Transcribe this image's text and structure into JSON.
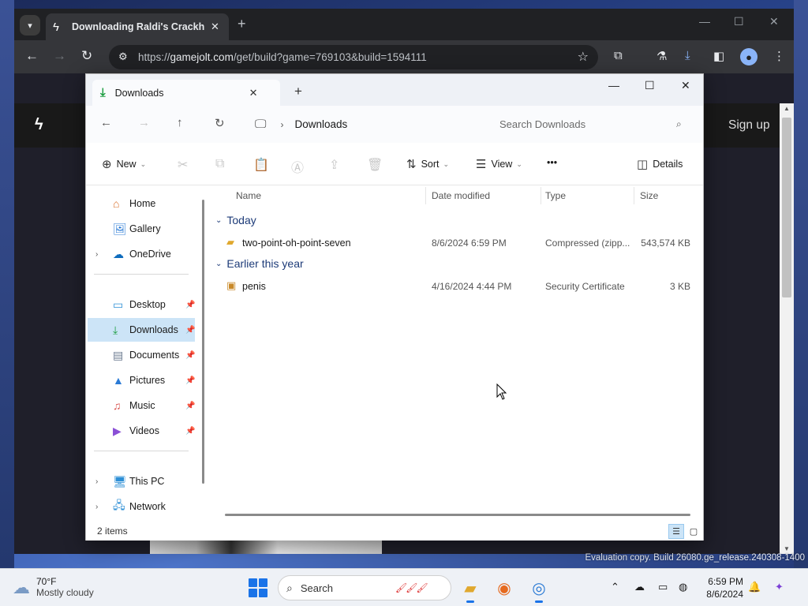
{
  "desktop": {
    "watermark": "Evaluation copy. Build 26080.ge_release.240308-1400"
  },
  "chrome": {
    "tab_title": "Downloading Raldi's Crackhou",
    "url_prefix": "https://",
    "url_host": "gamejolt.com",
    "url_path": "/get/build?game=769103&build=1594111",
    "page": {
      "signup": "Sign up"
    }
  },
  "explorer": {
    "tab_label": "Downloads",
    "location": "Downloads",
    "search_placeholder": "Search Downloads",
    "commands": {
      "new": "New",
      "sort": "Sort",
      "view": "View",
      "more": "•••",
      "details": "Details"
    },
    "nav_items": [
      {
        "label": "Home",
        "icon": "home-icon",
        "pinned": false,
        "expandable": false
      },
      {
        "label": "Gallery",
        "icon": "gallery-icon",
        "pinned": false,
        "expandable": false
      },
      {
        "label": "OneDrive",
        "icon": "cloud-icon",
        "pinned": false,
        "expandable": true
      },
      {
        "label": "Desktop",
        "icon": "desktop-icon",
        "pinned": true,
        "expandable": false
      },
      {
        "label": "Downloads",
        "icon": "download-icon",
        "pinned": true,
        "expandable": false,
        "selected": true
      },
      {
        "label": "Documents",
        "icon": "documents-icon",
        "pinned": true,
        "expandable": false
      },
      {
        "label": "Pictures",
        "icon": "pictures-icon",
        "pinned": true,
        "expandable": false
      },
      {
        "label": "Music",
        "icon": "music-icon",
        "pinned": true,
        "expandable": false
      },
      {
        "label": "Videos",
        "icon": "videos-icon",
        "pinned": true,
        "expandable": false
      },
      {
        "label": "This PC",
        "icon": "pc-icon",
        "pinned": false,
        "expandable": true
      },
      {
        "label": "Network",
        "icon": "network-icon",
        "pinned": false,
        "expandable": true
      }
    ],
    "columns": {
      "name": "Name",
      "date": "Date modified",
      "type": "Type",
      "size": "Size"
    },
    "groups": [
      {
        "label": "Today",
        "files": [
          {
            "name": "two-point-oh-point-seven",
            "date": "8/6/2024 6:59 PM",
            "type": "Compressed (zipp...",
            "size": "543,574 KB",
            "icon": "zip-folder-icon"
          }
        ]
      },
      {
        "label": "Earlier this year",
        "files": [
          {
            "name": "penis",
            "date": "4/16/2024 4:44 PM",
            "type": "Security Certificate",
            "size": "3 KB",
            "icon": "certificate-icon"
          }
        ]
      }
    ],
    "status": "2 items"
  },
  "taskbar": {
    "weather_temp": "70°F",
    "weather_cond": "Mostly cloudy",
    "search_label": "Search",
    "time": "6:59 PM",
    "date": "8/6/2024"
  },
  "colors": {
    "accent": "#1a73e8",
    "selection": "#cce4f7",
    "chrome_dark": "#202124",
    "group_header": "#1d3b78"
  }
}
